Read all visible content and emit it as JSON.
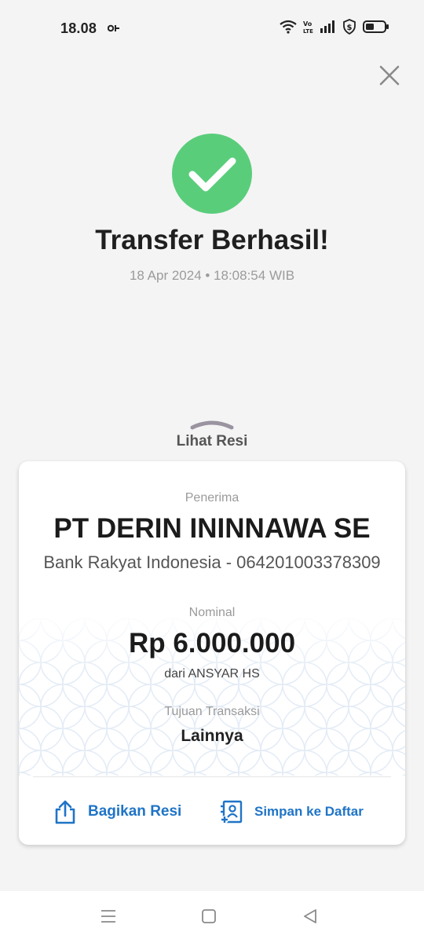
{
  "status_bar": {
    "time": "18.08",
    "icons": [
      "notification-icon",
      "wifi-icon",
      "volte-icon",
      "signal-icon",
      "shield-icon",
      "battery-icon"
    ]
  },
  "header": {
    "title": "Transfer Berhasil!",
    "datetime": "18 Apr 2024 • 18:08:54 WIB"
  },
  "receipt_toggle": {
    "label": "Lihat Resi"
  },
  "receipt": {
    "recipient_label": "Penerima",
    "recipient_name": "PT DERIN ININNAWA SE",
    "recipient_bank": "Bank Rakyat Indonesia - 064201003378309",
    "amount_label": "Nominal",
    "amount": "Rp 6.000.000",
    "sender": "dari ANSYAR HS",
    "purpose_label": "Tujuan Transaksi",
    "purpose": "Lainnya"
  },
  "actions": {
    "share_label": "Bagikan Resi",
    "save_label": "Simpan ke Daftar"
  },
  "colors": {
    "success": "#5acd7b",
    "accent": "#1f74c7",
    "background": "#f4f4f4"
  }
}
